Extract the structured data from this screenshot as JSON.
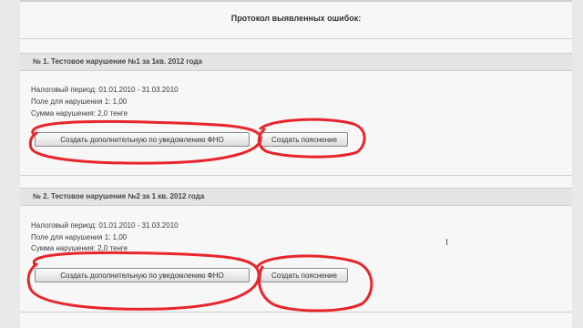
{
  "report": {
    "title": "Протокол выявленных ошибок:"
  },
  "violations": [
    {
      "title": "№ 1. Тестовое нарушение №1 за 1кв. 2012 года",
      "period": "Налоговый период: 01.01.2010 - 31.03.2010",
      "field": "Поле для нарушения 1: 1,00",
      "amount": "Сумма нарушения: 2,0 тенге",
      "button_additional": "Создать дополнительную по уведомлению ФНО",
      "button_explanation": "Создать пояснение"
    },
    {
      "title": "№ 2. Тестовое нарушение №2 за 1 кв. 2012 года",
      "period": "Налоговый период: 01.01.2010 - 31.03.2010",
      "field": "Поле для нарушения 1: 1,00",
      "amount": "Сумма нарушения: 2,0 тенге",
      "button_additional": "Создать дополнительную по уведомлению ФНО",
      "button_explanation": "Создать пояснение"
    }
  ],
  "colors": {
    "highlight": "#e8252c",
    "section_header": "#e4e4e4",
    "page": "#f7f7f7"
  },
  "icons": {
    "cursor": "text-cursor-icon"
  }
}
